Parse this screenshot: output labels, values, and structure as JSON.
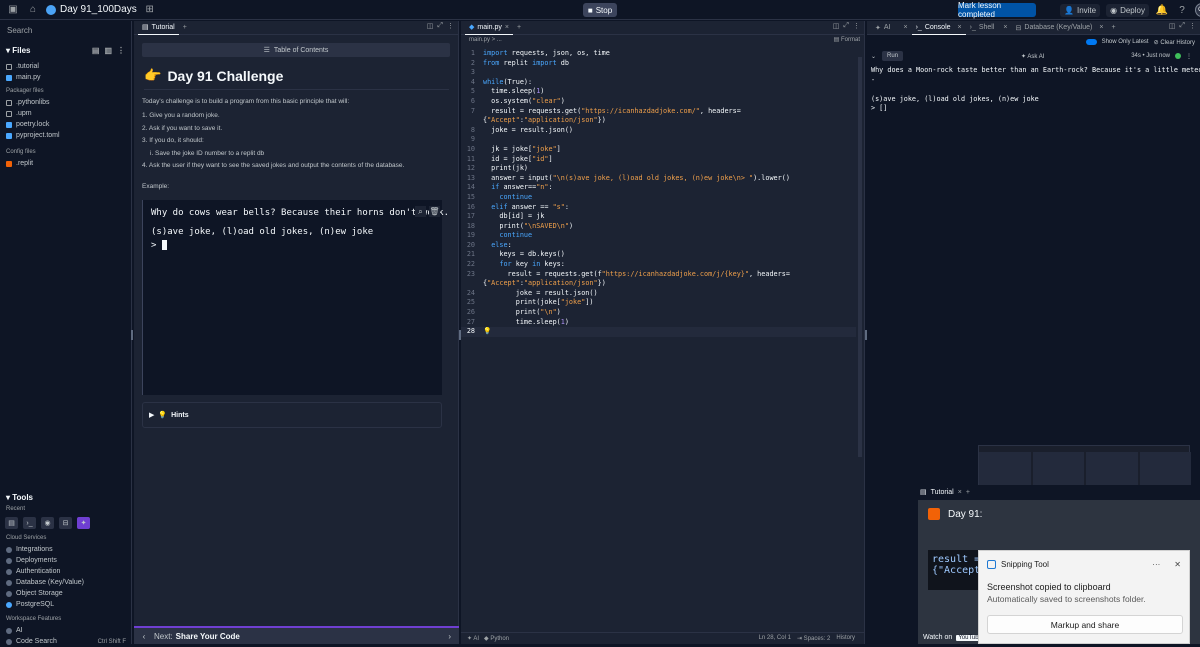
{
  "topbar": {
    "repl_name": "Day 91_100Days",
    "stop_label": "Stop",
    "mark_complete_label": "Mark lesson completed",
    "invite_label": "Invite",
    "deploy_label": "Deploy",
    "avatar_initials": "CL"
  },
  "sidebar": {
    "search_placeholder": "Search",
    "files_label": "Files",
    "files": [
      ".tutorial",
      "main.py"
    ],
    "packager_section": "Packager files",
    "packager_files": [
      ".pythonlibs",
      ".upm",
      "poetry.lock",
      "pyproject.toml"
    ],
    "config_section": "Config files",
    "config_files": [
      ".replit"
    ],
    "tools_label": "Tools",
    "recent_label": "Recent",
    "cloud_services_label": "Cloud Services",
    "services": [
      "Integrations",
      "Deployments",
      "Authentication",
      "Database (Key/Value)",
      "Object Storage",
      "PostgreSQL"
    ],
    "workspace_features_label": "Workspace Features",
    "features": [
      "AI",
      "Code Search"
    ],
    "code_search_shortcut": "Ctrl Shift F"
  },
  "tutorial": {
    "tab_label": "Tutorial",
    "toc_label": "Table of Contents",
    "title_emoji": "👉",
    "title": "Day 91 Challenge",
    "intro": "Today's challenge is to build a program from this basic principle that will:",
    "steps": [
      "1. Give you a random joke.",
      "2. Ask if you want to save it.",
      "3. If you do, it should:",
      "i. Save the joke ID number to a replit db",
      "4. Ask the user if they want to see the saved jokes and output the contents of the database."
    ],
    "example_label": "Example:",
    "terminal_lines": [
      "Why do cows wear bells? Because their horns don't work.",
      "",
      "(s)ave joke, (l)oad old jokes, (n)ew joke",
      "> "
    ],
    "hints_label": "Hints",
    "next_label": "Next:",
    "next_title": "Share Your Code"
  },
  "editor": {
    "tab_label": "main.py",
    "breadcrumb": "main.py > ...",
    "format_label": "Format",
    "lines": [
      "import requests, json, os, time",
      "from replit import db",
      "",
      "while(True):",
      "  time.sleep(1)",
      "  os.system(\"clear\")",
      "  result = requests.get(\"https://icanhazdadjoke.com/\", headers=",
      "  joke = result.json()",
      "",
      "  jk = joke[\"joke\"]",
      "  id = joke[\"id\"]",
      "  print(jk)",
      "  answer = input(\"\\n(s)ave joke, (l)oad old jokes, (n)ew joke\\n> \").lower()",
      "  if answer==\"n\":",
      "    continue",
      "  elif answer == \"s\":",
      "    db[id] = jk",
      "    print(\"\\nSAVED\\n\")",
      "    continue",
      "  else:",
      "    keys = db.keys()",
      "    for key in keys:",
      "      result = requests.get(f\"https://icanhazdadjoke.com/j/{key}\", headers=",
      "        joke = result.json()",
      "        print(joke[\"joke\"])",
      "        print(\"\\n\")",
      "        time.sleep(1)",
      ""
    ],
    "wrap_7": "{\"Accept\":\"application/json\"})",
    "wrap_23": "{\"Accept\":\"application/json\"})",
    "status_ai": "AI",
    "status_lang": "Python",
    "status_pos": "Ln 28, Col 1",
    "status_spaces": "Spaces: 2",
    "status_history": "History"
  },
  "console": {
    "tabs": [
      "AI",
      "Console",
      "Shell",
      "Database (Key/Value)"
    ],
    "show_only_latest": "Show Only Latest",
    "clear_history": "Clear History",
    "run_label": "Run",
    "ask_ai": "Ask AI",
    "run_meta": "34s • Just now",
    "output": "Why does a Moon-rock taste better than an Earth-rock? Because it's a little meteor\n-\n\n(s)ave joke, (l)oad old jokes, (n)ew joke\n> []"
  },
  "video": {
    "tab_label": "Tutorial",
    "title": "Day 91:",
    "code_snippet": "result =\n{\"Accept",
    "watch_on": "Watch on",
    "youtube": "YouTube"
  },
  "toast": {
    "app_name": "Snipping Tool",
    "title": "Screenshot copied to clipboard",
    "subtitle": "Automatically saved to screenshots folder.",
    "button": "Markup and share"
  }
}
